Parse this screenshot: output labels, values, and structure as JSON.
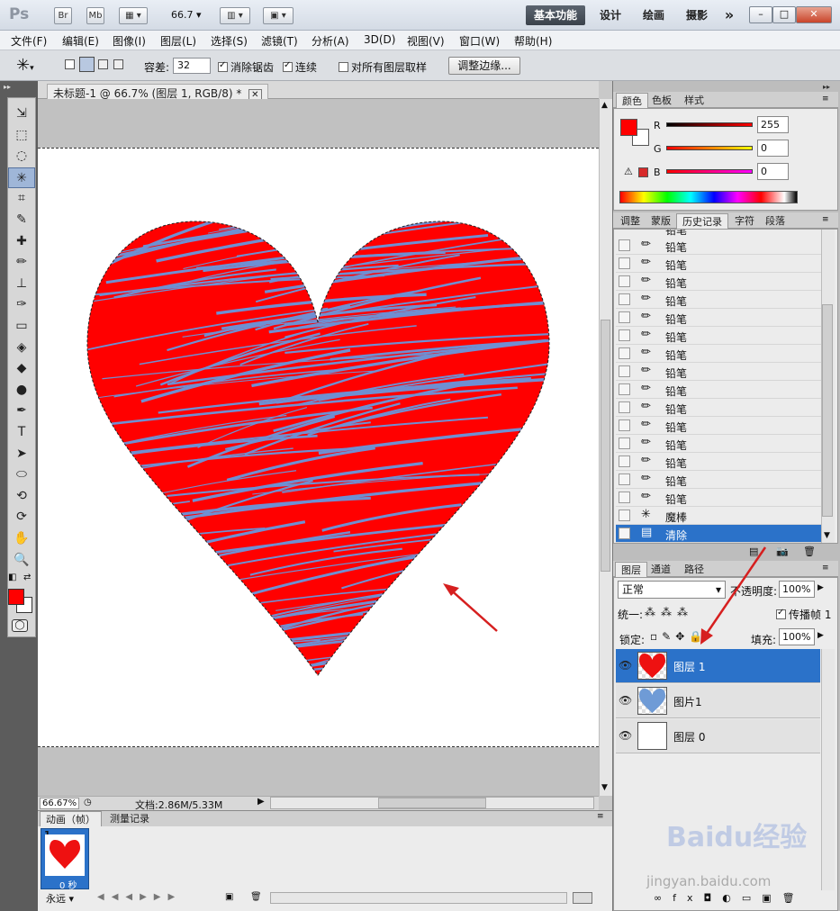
{
  "app": {
    "logo": "Ps",
    "launchers": [
      "Br",
      "Mb"
    ],
    "zoom_combo": "66.7",
    "workspaces": [
      "基本功能",
      "设计",
      "绘画",
      "摄影"
    ],
    "workspace_more": "»",
    "window_controls": [
      "–",
      "□",
      "✕"
    ]
  },
  "menubar": {
    "items": [
      "文件(F)",
      "编辑(E)",
      "图像(I)",
      "图层(L)",
      "选择(S)",
      "滤镜(T)",
      "分析(A)",
      "3D(D)",
      "视图(V)",
      "窗口(W)",
      "帮助(H)"
    ]
  },
  "options": {
    "tolerance_label": "容差:",
    "tolerance_value": "32",
    "antialias_label": "消除锯齿",
    "antialias_checked": true,
    "contiguous_label": "连续",
    "contiguous_checked": true,
    "sample_all_label": "对所有图层取样",
    "sample_all_checked": false,
    "refine_edge_button": "调整边缘..."
  },
  "toolbox": {
    "tools": [
      "move-icon",
      "marquee-icon",
      "lasso-icon",
      "magic-wand-icon",
      "crop-icon",
      "eyedropper-icon",
      "healing-icon",
      "brush-icon",
      "stamp-icon",
      "history-brush-icon",
      "eraser-icon",
      "bucket-icon",
      "blur-icon",
      "dodge-icon",
      "pen-icon",
      "type-icon",
      "path-select-icon",
      "shape-icon",
      "3d-rotate-icon",
      "3d-orbit-icon",
      "hand-icon",
      "zoom-icon"
    ],
    "tool_glyphs": [
      "⇲",
      "⬚",
      "◌",
      "✳",
      "⌗",
      "✎",
      "✚",
      "✏",
      "⊥",
      "✑",
      "▭",
      "◈",
      "◆",
      "●",
      "✒",
      "T",
      "➤",
      "⬭",
      "⟲",
      "⟳",
      "✋",
      "🔍"
    ],
    "foreground_color": "#ff0000",
    "background_color": "#ffffff"
  },
  "document": {
    "tab_title": "未标题-1 @ 66.7% (图层 1, RGB/8) *",
    "tab_close": "✕",
    "zoom_status": "66.67%",
    "doc_size": "文档:2.86M/5.33M",
    "heart_color": "#ff0000",
    "stroke_color": "#6f8fd2"
  },
  "animation_panel": {
    "tabs": [
      "动画（帧）",
      "测量记录"
    ],
    "frame_number": "1",
    "frame_time": "0 秒",
    "loop_option": "永远"
  },
  "color_panel": {
    "tabs": [
      "颜色",
      "色板",
      "样式"
    ],
    "channels": [
      {
        "label": "R",
        "value": "255"
      },
      {
        "label": "G",
        "value": "0"
      },
      {
        "label": "B",
        "value": "0"
      }
    ],
    "foreground": "#ff0000"
  },
  "history_panel": {
    "tabs": [
      "调整",
      "蒙版",
      "历史记录",
      "字符",
      "段落"
    ],
    "items": [
      {
        "icon": "pencil-icon",
        "label": "铅笔"
      },
      {
        "icon": "pencil-icon",
        "label": "铅笔"
      },
      {
        "icon": "pencil-icon",
        "label": "铅笔"
      },
      {
        "icon": "pencil-icon",
        "label": "铅笔"
      },
      {
        "icon": "pencil-icon",
        "label": "铅笔"
      },
      {
        "icon": "pencil-icon",
        "label": "铅笔"
      },
      {
        "icon": "pencil-icon",
        "label": "铅笔"
      },
      {
        "icon": "pencil-icon",
        "label": "铅笔"
      },
      {
        "icon": "pencil-icon",
        "label": "铅笔"
      },
      {
        "icon": "pencil-icon",
        "label": "铅笔"
      },
      {
        "icon": "pencil-icon",
        "label": "铅笔"
      },
      {
        "icon": "pencil-icon",
        "label": "铅笔"
      },
      {
        "icon": "pencil-icon",
        "label": "铅笔"
      },
      {
        "icon": "pencil-icon",
        "label": "铅笔"
      },
      {
        "icon": "pencil-icon",
        "label": "铅笔"
      },
      {
        "icon": "magic-wand-icon",
        "label": "魔棒"
      },
      {
        "icon": "clear-icon",
        "label": "清除"
      }
    ],
    "selected_index": 16,
    "partial_top_label": "铅笔"
  },
  "layers_panel": {
    "tabs": [
      "图层",
      "通道",
      "路径"
    ],
    "blend_mode": "正常",
    "opacity_label": "不透明度:",
    "opacity_value": "100%",
    "unify_label": "统一:",
    "propagate_label": "传播帧",
    "propagate_value": "1",
    "lock_label": "锁定:",
    "fill_label": "填充:",
    "fill_value": "100%",
    "layers": [
      {
        "name": "图层 1",
        "selected": true
      },
      {
        "name": "图片1",
        "selected": false
      },
      {
        "name": "图层 0",
        "selected": false
      }
    ]
  },
  "watermark": {
    "brand": "Baidu经验",
    "url": "jingyan.baidu.com"
  }
}
